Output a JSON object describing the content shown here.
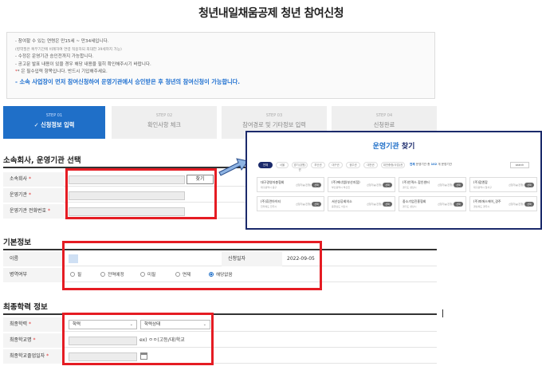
{
  "page": {
    "title": "청년내일채움공제 청년 참여신청"
  },
  "notice": {
    "lines": [
      {
        "text": "- 참여할 수 있는 연령은 만15세 ~ 만34세입니다.",
        "style": "normal"
      },
      {
        "text": "(병역필은 복무기간에 비례하여 연령 적용하되 최대한 39세까지 가능)",
        "style": "small"
      },
      {
        "text": "- 수정은 운영기관 승인전까지 가능합니다.",
        "style": "normal"
      },
      {
        "text": "- 공고문 발표 내용이 있을 경우 해당 내용을 필히 확인해주시기 바랍니다.",
        "style": "normal"
      },
      {
        "text": "* 은 필수입력 항목입니다. 반드시 기입해주세요.",
        "style": "required"
      }
    ],
    "highlight": "- 소속 사업장이 먼저 참여신청하여 운영기관에서 승인받은 후 청년의 참여신청이 가능합니다."
  },
  "steps": [
    {
      "num": "STEP 01",
      "label": "✓ 신청정보 입력",
      "active": true
    },
    {
      "num": "STEP 02",
      "label": "확인사항 체크",
      "active": false
    },
    {
      "num": "STEP 03",
      "label": "참여경로 및 기타정보 입력",
      "active": false
    },
    {
      "num": "STEP 04",
      "label": "신청완료",
      "active": false
    }
  ],
  "company_section": {
    "title": "소속회사, 운영기관 선택",
    "rows": [
      {
        "label": "소속회사",
        "required": true
      },
      {
        "label": "운영기관",
        "required": true
      },
      {
        "label": "운영기관 전화번호",
        "required": true
      }
    ],
    "find_button": "찾기"
  },
  "basic_section": {
    "title": "기본정보",
    "name_label": "이름",
    "apply_date_label": "신청일자",
    "apply_date_value": "2022-09-05",
    "military_label": "병역여부",
    "military_options": [
      "필",
      "전역예정",
      "미필",
      "면제",
      "해당없음"
    ],
    "military_selected": "해당없음"
  },
  "education_section": {
    "title": "최종학력 정보",
    "rows": [
      {
        "label": "최종학력",
        "required": true
      },
      {
        "label": "최종학교명",
        "required": true
      },
      {
        "label": "최종학교졸업일자",
        "required": true
      }
    ],
    "degree_select": "학력",
    "status_select": "학력상태",
    "school_hint": "ex) ㅇㅇ(고등/대)학교"
  },
  "popup": {
    "title_main": "운영기관",
    "title_suffix": " 찾기",
    "tabs": [
      "전체",
      "서울",
      "경기(강원)권",
      "부산권",
      "대구권",
      "광주권",
      "대전권",
      "대전충청(사업)권"
    ],
    "count_prefix": "전체",
    "count_text": " 운영기관 총 ",
    "count_value": "102",
    "count_suffix": " 개 운영기관",
    "search_label": "search",
    "cards": [
      {
        "org": "대구경영자총협회",
        "addr": "대구광역시 중구",
        "status": "신청가능(진행)",
        "btn": "선택"
      },
      {
        "org": "(주)에너엠(부산지점)",
        "addr": "부산광역시 부산진",
        "status": "신청가능(진행)",
        "btn": "선택"
      },
      {
        "org": "(주)인덱스 잡인센터",
        "addr": "경기도 성남시",
        "status": "신청가능(진행)",
        "btn": "선택"
      },
      {
        "org": "(주)잡앤잡",
        "addr": "대구광역시 달서구",
        "status": "신청가능(진행)",
        "btn": "선택"
      },
      {
        "org": "(주)휴먼아이티",
        "addr": "전라북도 전주시",
        "status": "신청가능(진행)",
        "btn": "선택"
      },
      {
        "org": "서산상공회의소",
        "addr": "충청남도 서산시",
        "status": "신청가능(진행)",
        "btn": "선택"
      },
      {
        "org": "중소기업진흥협회",
        "addr": "경기도 성남시",
        "status": "신청가능(진행)",
        "btn": "선택"
      },
      {
        "org": "(주)피에스에이_경주",
        "addr": "경상북도 경주시",
        "status": "신청가능(진행)",
        "btn": "선택"
      }
    ]
  },
  "colors": {
    "accent_blue": "#1f6fc8",
    "popup_navy": "#1b2a6b",
    "highlight_red": "#e51c23",
    "required_red": "#e03030"
  }
}
